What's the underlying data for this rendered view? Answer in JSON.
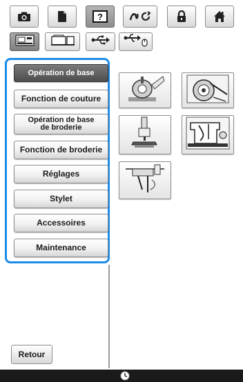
{
  "toolbar": {
    "tabs": [
      {
        "icon": "camera-icon"
      },
      {
        "icon": "document-icon"
      },
      {
        "icon": "help-icon",
        "label": "?",
        "active": true
      },
      {
        "icon": "setting-mode-icon"
      },
      {
        "icon": "lock-icon"
      },
      {
        "icon": "home-icon"
      }
    ]
  },
  "subtoolbar": {
    "tabs": [
      {
        "icon": "embroidery-machine-icon",
        "active": true
      },
      {
        "icon": "sewing-machine-icon"
      },
      {
        "icon": "usb-icon"
      },
      {
        "icon": "usb-mouse-icon"
      }
    ]
  },
  "menu": {
    "items": [
      {
        "label": "Opération de base",
        "active": true
      },
      {
        "label": "Fonction de couture"
      },
      {
        "label_line1": "Opération de base",
        "label_line2": "de broderie"
      },
      {
        "label": "Fonction de broderie"
      },
      {
        "label": "Réglages"
      },
      {
        "label": "Stylet"
      },
      {
        "label": "Accessoires"
      },
      {
        "label": "Maintenance"
      }
    ]
  },
  "content": {
    "icons": [
      "bobbin-winding-icon",
      "bobbin-case-icon",
      "presser-foot-icon",
      "machine-threading-icon",
      "needle-threader-icon"
    ]
  },
  "footer": {
    "back_label": "Retour",
    "status_icon": "clock-icon"
  },
  "colors": {
    "menu_highlight": "#1c8be8",
    "active_button": "#5a5a5a"
  }
}
